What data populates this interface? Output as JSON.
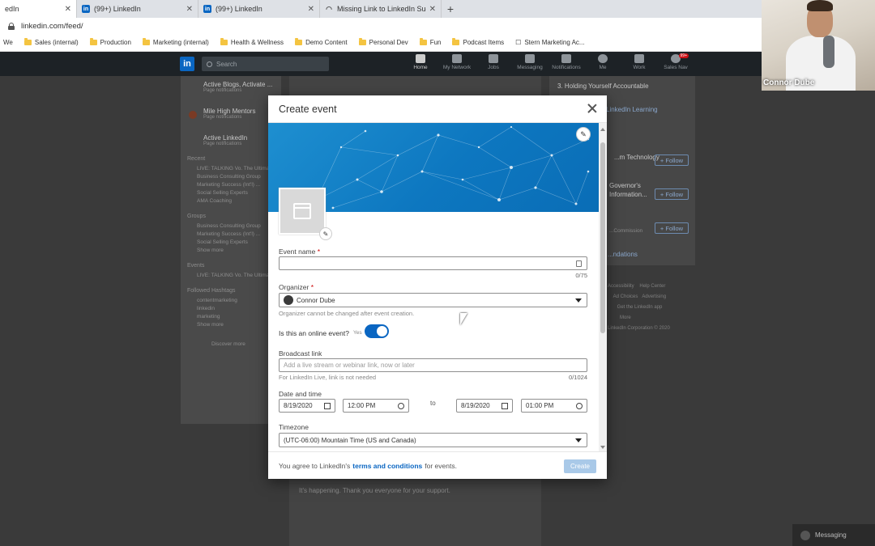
{
  "browser": {
    "tabs": [
      {
        "title": "edIn",
        "active": true,
        "icon": "linkedin-icon"
      },
      {
        "title": "(99+) LinkedIn",
        "active": false,
        "icon": "linkedin-icon"
      },
      {
        "title": "(99+) LinkedIn",
        "active": false,
        "icon": "linkedin-icon"
      },
      {
        "title": "Missing Link to LinkedIn Success",
        "active": false,
        "icon": "wifi-icon"
      }
    ],
    "new_tab": "+",
    "url": "linkedin.com/feed/",
    "bookmarks": [
      "We",
      "Sales (internal)",
      "Production",
      "Marketing (internal)",
      "Health & Wellness",
      "Demo Content",
      "Personal Dev",
      "Fun",
      "Podcast Items",
      "Stern Marketing Ac..."
    ]
  },
  "linkedin_nav": {
    "logo": "in",
    "search_placeholder": "Search",
    "items": [
      {
        "label": "Home"
      },
      {
        "label": "My Network"
      },
      {
        "label": "Jobs"
      },
      {
        "label": "Messaging"
      },
      {
        "label": "Notifications"
      },
      {
        "label": "Me"
      },
      {
        "label": "Work"
      },
      {
        "label": "Sales Nav"
      }
    ],
    "sales_nav_badge": "99+"
  },
  "background": {
    "left_pages": [
      {
        "title": "Active Blogs, Activate ...",
        "sub": "Page notifications"
      },
      {
        "title": "Mile High Mentors",
        "sub": "Page notifications"
      },
      {
        "title": "Active LinkedIn",
        "sub": "Page notifications"
      }
    ],
    "recent_label": "Recent",
    "recent_items": [
      "LIVE: TALKING Vo. The Ultimate",
      "Business Consulting Group",
      "Marketing Success (Int'l) ...",
      "Social Selling Experts",
      "AMA Coaching"
    ],
    "groups_label": "Groups",
    "group_items": [
      "Business Consulting Group",
      "Marketing Success (Int'l) ...",
      "Social Selling Experts"
    ],
    "show_more": "Show more",
    "events_label": "Events",
    "event_items": [
      "LIVE: TALKING Vo. The Ultimate"
    ],
    "hashtags_label": "Followed Hashtags",
    "hashtag_items": [
      "contentmarketing",
      "linkedin",
      "marketing"
    ],
    "discover_more": "Discover more",
    "center_heading": "3. Holding Yourself Accountable",
    "center_sub": "LinkedIn Learning",
    "center_footer": "It's happening. Thank you everyone for your support.",
    "right_items": [
      "...m Technology",
      "Governor's Information...",
      "...Commission"
    ],
    "follow_label": "+ Follow",
    "right_more": "...ndations",
    "footer_links": [
      "Accessibility",
      "Help Center",
      "Ad Choices",
      "Advertising",
      "Get the LinkedIn app",
      "More",
      "LinkedIn Corporation © 2020"
    ]
  },
  "webcam": {
    "name": "Connor Dube"
  },
  "modal": {
    "title": "Create event",
    "event_name_label": "Event name",
    "required_mark": "*",
    "event_name_value": "",
    "event_name_counter": "0/75",
    "organizer_label": "Organizer",
    "organizer_value": "Connor Dube",
    "organizer_hint": "Organizer cannot be changed after event creation.",
    "online_question": "Is this an online event?",
    "online_value": "Yes",
    "online_on": true,
    "broadcast_label": "Broadcast link",
    "broadcast_placeholder": "Add a live stream or webinar link, now or later",
    "broadcast_hint": "For LinkedIn Live, link is not needed",
    "broadcast_counter": "0/1024",
    "datetime_label": "Date and time",
    "start_date": "8/19/2020",
    "start_time": "12:00 PM",
    "to_label": "to",
    "end_date": "8/19/2020",
    "end_time": "01:00 PM",
    "timezone_label": "Timezone",
    "timezone_value": "(UTC-06:00) Mountain Time (US and Canada)",
    "footer_prefix": "You agree to LinkedIn's",
    "footer_link": "terms and conditions",
    "footer_suffix": "for events.",
    "create_button": "Create"
  },
  "messaging_bar": {
    "label": "Messaging"
  },
  "colors": {
    "linkedin_blue": "#0a66c2",
    "banner_blue": "#1e8fd0",
    "create_disabled": "#a9c9e8"
  }
}
